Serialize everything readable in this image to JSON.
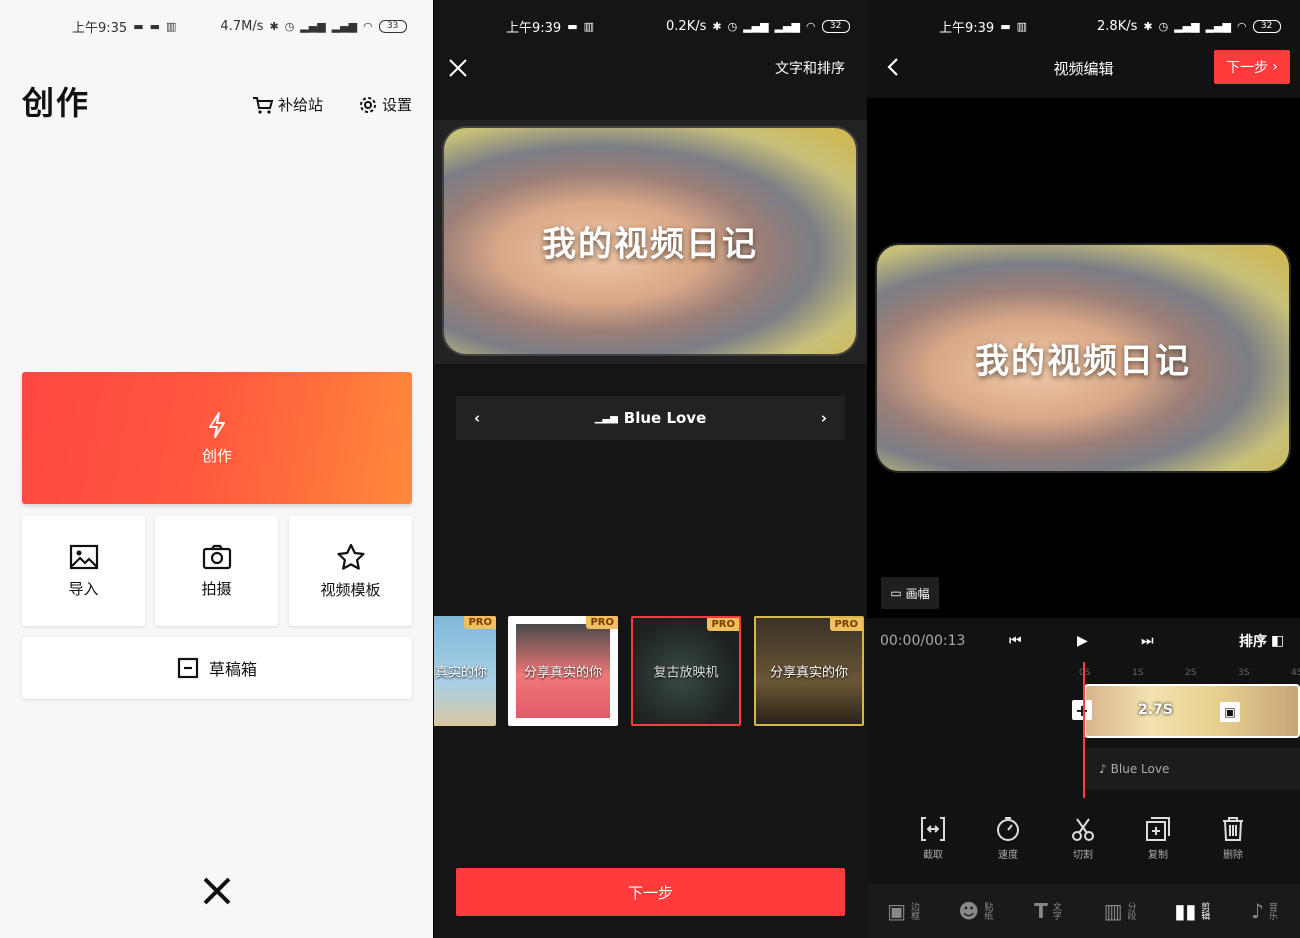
{
  "panel1": {
    "status": {
      "time": "上午9:35",
      "speed": "4.7M/s",
      "battery": "33"
    },
    "title": "创作",
    "store_label": "补给站",
    "settings_label": "设置",
    "create_label": "创作",
    "tiles": [
      {
        "label": "导入"
      },
      {
        "label": "拍摄"
      },
      {
        "label": "视频模板"
      }
    ],
    "draft_label": "草稿箱"
  },
  "panel2": {
    "status": {
      "time": "上午9:39",
      "speed": "0.2K/s",
      "battery": "32"
    },
    "header_right": "文字和排序",
    "video_caption": "我的视频日记",
    "music_name": "Blue Love",
    "templates": [
      {
        "text": "真实的你",
        "pro": "PRO",
        "selected": false
      },
      {
        "text": "分享真实的你",
        "pro": "PRO",
        "selected": false
      },
      {
        "text": "复古放映机",
        "pro": "PRO",
        "selected": true
      },
      {
        "text": "分享真实的你",
        "pro": "PRO",
        "selected": false
      }
    ],
    "next_label": "下一步"
  },
  "panel3": {
    "status": {
      "time": "上午9:39",
      "speed": "2.8K/s",
      "battery": "32"
    },
    "title": "视频编辑",
    "next_label": "下一步",
    "video_caption": "我的视频日记",
    "canvas_label": "画幅",
    "timecode": "00:00/00:13",
    "sort_label": "排序",
    "ruler": [
      "0S",
      "1S",
      "2S",
      "3S",
      "4S"
    ],
    "clip_duration": "2.7S",
    "audio_label": "Blue Love",
    "tools": [
      {
        "label": "截取"
      },
      {
        "label": "速度"
      },
      {
        "label": "切割"
      },
      {
        "label": "复制"
      },
      {
        "label": "删除"
      }
    ],
    "tabs": [
      {
        "label": "边框",
        "active": false
      },
      {
        "label": "贴纸",
        "active": false
      },
      {
        "label": "文字",
        "active": false
      },
      {
        "label": "分段",
        "active": false
      },
      {
        "label": "剪辑",
        "active": true
      },
      {
        "label": "音乐",
        "active": false
      }
    ]
  }
}
